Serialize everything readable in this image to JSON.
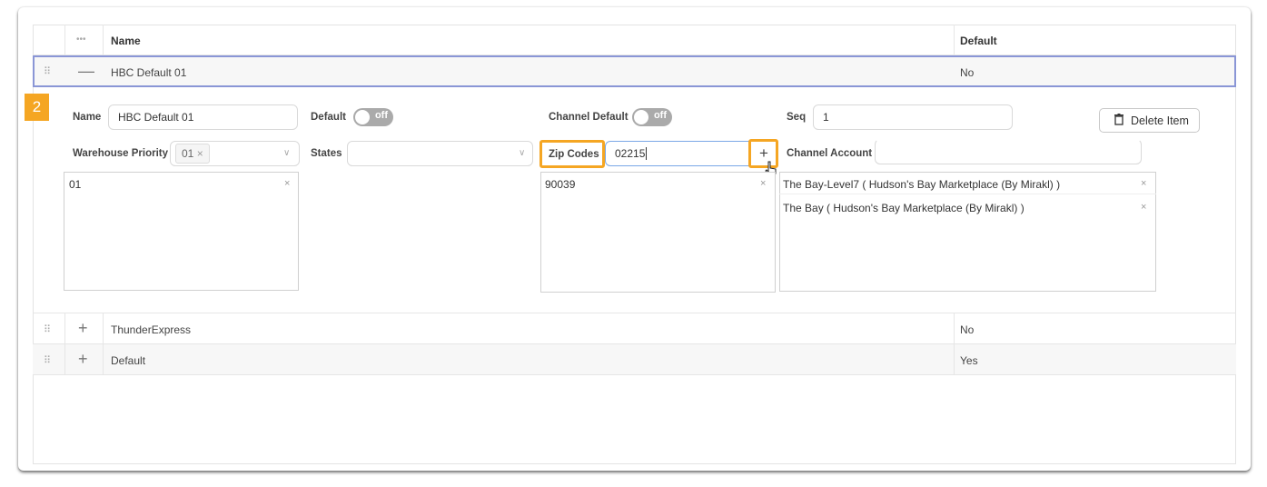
{
  "table": {
    "menu_icon": "•••",
    "col_name": "Name",
    "col_default": "Default",
    "rows": [
      {
        "expander": "—",
        "name": "HBC Default 01",
        "default": "No"
      },
      {
        "expander": "+",
        "name": "ThunderExpress",
        "default": "No"
      },
      {
        "expander": "+",
        "name": "Default",
        "default": "Yes"
      }
    ],
    "drag_glyph": "⠿"
  },
  "detail": {
    "step_badge": "2",
    "name_label": "Name",
    "name_value": "HBC Default 01",
    "default_label": "Default",
    "default_toggle": "off",
    "channel_default_label": "Channel Default",
    "channel_default_toggle": "off",
    "seq_label": "Seq",
    "seq_value": "1",
    "delete_button": "Delete Item",
    "warehouse_priority_label": "Warehouse Priority",
    "warehouse_tag": "01",
    "warehouse_list": [
      "01"
    ],
    "states_label": "States",
    "zip_codes_label": "Zip Codes",
    "zip_input": "02215",
    "zip_add": "+",
    "zip_list": [
      "90039"
    ],
    "channel_account_label": "Channel Account",
    "channel_account_value": "",
    "channel_list": [
      "The Bay-Level7 ( Hudson's Bay Marketplace (By Mirakl) )",
      "The Bay ( Hudson's Bay Marketplace (By Mirakl) )"
    ],
    "remove_glyph": "×",
    "chevron_glyph": "∨",
    "trash_glyph": "🗑"
  },
  "colors": {
    "accent": "#f5a623",
    "selected_border": "#8a96d6",
    "toggle_off": "#aaaaaa"
  }
}
